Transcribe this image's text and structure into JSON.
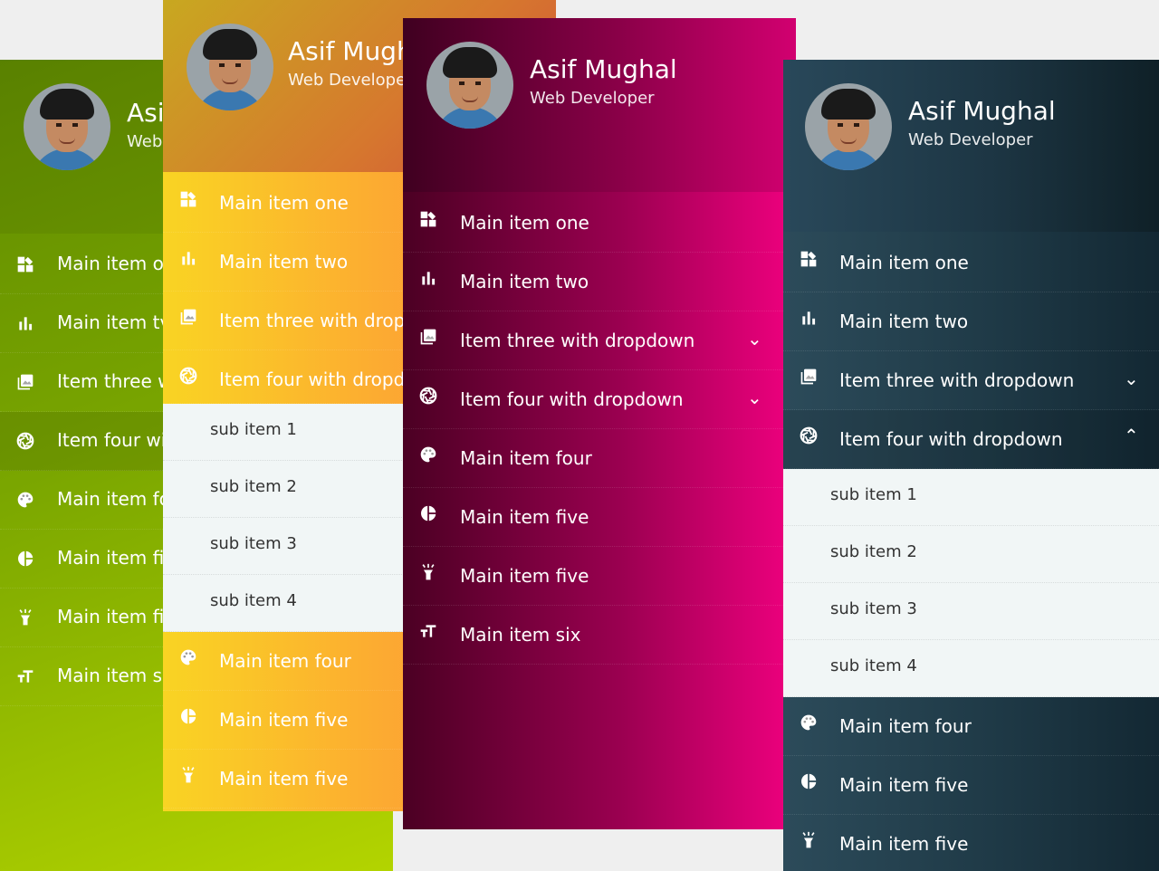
{
  "profile": {
    "name": "Asif Mughal",
    "role": "Web Developer"
  },
  "panel1": {
    "name": "Asi",
    "role": "Web",
    "items": [
      "Main item o",
      "Main item tv",
      "Item three w",
      "Item four wi",
      "Main item fo",
      "Main item fi",
      "Main item fi",
      "Main item si"
    ]
  },
  "panel2": {
    "name": "Asif Mugh",
    "role": "Web Develope",
    "items": [
      "Main item one",
      "Main item two",
      "Item three with drop",
      "Item four with dropdo"
    ],
    "subitems": [
      "sub item 1",
      "sub item 2",
      "sub item 3",
      "sub item 4"
    ],
    "items_after": [
      "Main item four",
      "Main item five",
      "Main item five"
    ]
  },
  "panel3": {
    "items": [
      "Main item one",
      "Main item two",
      "Item three with dropdown",
      "Item four with dropdown",
      "Main item four",
      "Main item five",
      "Main item five",
      "Main item six"
    ]
  },
  "panel4": {
    "items": [
      "Main item one",
      "Main item two",
      "Item three with dropdown",
      "Item four with dropdown"
    ],
    "subitems": [
      "sub item 1",
      "sub item 2",
      "sub item 3",
      "sub item 4"
    ],
    "items_after": [
      "Main item four",
      "Main item five",
      "Main item five"
    ]
  },
  "icons": [
    "dashboard-icon",
    "bar-chart-icon",
    "image-icon",
    "aperture-icon",
    "palette-icon",
    "pie-chart-icon",
    "flashlight-icon",
    "text-size-icon"
  ],
  "colors": {
    "green_top": "#5f8a00",
    "green_bottom": "#b3d400",
    "orange_left": "#f9d423",
    "orange_right": "#ff8a3d",
    "magenta_left": "#4b0023",
    "magenta_right": "#f0007f",
    "slate_left": "#2c4b5a",
    "slate_right": "#0f2027"
  }
}
